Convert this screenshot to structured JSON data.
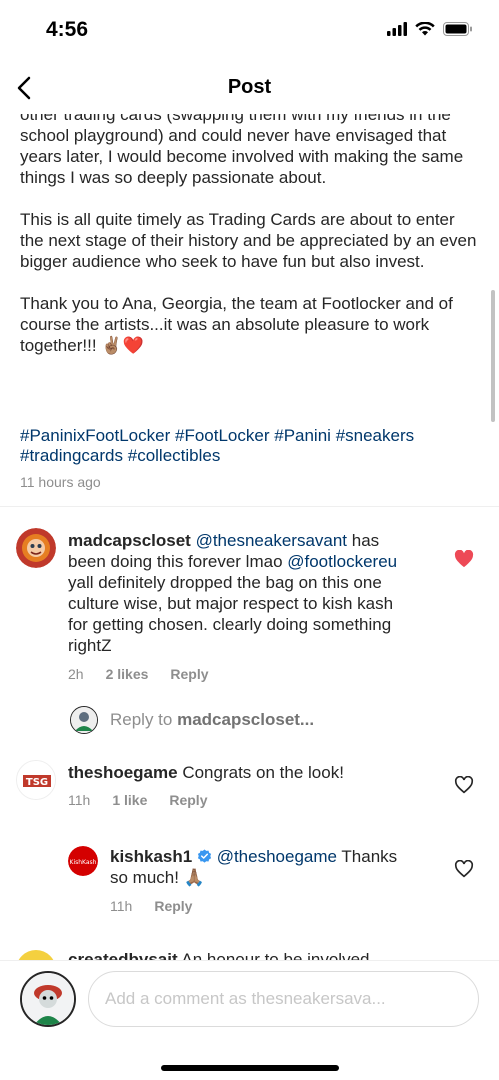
{
  "status_bar": {
    "time": "4:56"
  },
  "nav": {
    "title": "Post"
  },
  "caption": {
    "cut_line": "other trading cards (swapping them with my friends in",
    "para1": "the school playground) and could never have envisaged that years later, I would become involved with making the same things I was so deeply passionate about.",
    "para2": "This is all quite timely as Trading Cards are about to enter the next stage of their history and be appreciated by an even bigger audience who seek to have fun but also invest.",
    "para3": "Thank you to Ana, Georgia, the team at Footlocker and of course the artists...it was an absolute pleasure to work together!!!",
    "para3_emoji": "✌🏽❤️",
    "hashtags": [
      "#PaninixFootLocker",
      "#FootLocker",
      "#Panini",
      "#sneakers",
      "#tradingcards",
      "#collectibles"
    ],
    "time": "11 hours ago"
  },
  "comments": [
    {
      "username": "madcapscloset",
      "mention1": "@thesneakersavant",
      "text1": " has been doing this forever lmao ",
      "mention2": "@footlockereu",
      "text2": " yall definitely dropped the bag on this one culture wise, but major respect to kish kash for getting chosen. clearly doing something rightZ",
      "time": "2h",
      "likes": "2 likes",
      "reply": "Reply",
      "liked": true,
      "heart_color": "#ed4956"
    },
    {
      "username": "theshoegame",
      "text": " Congrats on the look!",
      "time": "11h",
      "likes": "1 like",
      "reply": "Reply",
      "liked": false
    },
    {
      "username": "kishkash1",
      "verified": true,
      "mention": "@theshoegame",
      "text": " Thanks so much! ",
      "emoji": "🙏🏽",
      "time": "11h",
      "reply": "Reply",
      "liked": false
    }
  ],
  "reply_to": {
    "prefix": "Reply to ",
    "username": "madcapscloset..."
  },
  "cut_comment": {
    "username": "createdbysait",
    "text": " An honour to be involved"
  },
  "composer": {
    "placeholder": "Add a comment as thesneakersava..."
  },
  "colors": {
    "link": "#00376b",
    "muted": "#8e8e8e",
    "like_red": "#ed4956",
    "verified_blue": "#3897f0"
  }
}
